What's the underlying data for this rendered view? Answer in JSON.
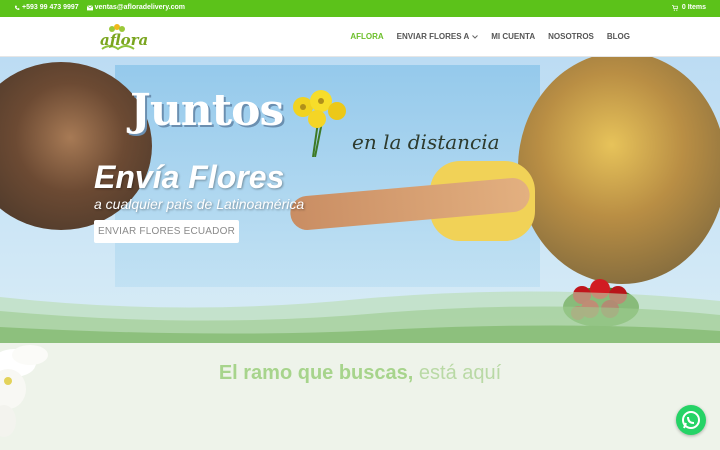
{
  "topbar": {
    "phone": "+593 99 473 9997",
    "email": "ventas@afloradelivery.com",
    "cart": "0 Items"
  },
  "header": {
    "logo_text": "aflora",
    "nav": [
      {
        "label": "AFLORA"
      },
      {
        "label": "ENVIAR FLORES A"
      },
      {
        "label": "MI CUENTA"
      },
      {
        "label": "NOSOTROS"
      },
      {
        "label": "BLOG"
      }
    ]
  },
  "hero": {
    "headline_large": "Juntos",
    "headline_script": "en la distancia",
    "title": "Envía Flores",
    "subtitle": "a cualquier país de Latinoamérica",
    "cta": "ENVIAR FLORES ECUADOR"
  },
  "section": {
    "headline_bold": "El ramo que buscas,",
    "headline_light": "está aquí"
  },
  "colors": {
    "topbar": "#5cc21a",
    "nav_active": "#6cbf2a",
    "whatsapp": "#25d366"
  },
  "icons": [
    "phone-icon",
    "mail-icon",
    "cart-icon",
    "chevron-down-icon",
    "whatsapp-icon"
  ]
}
